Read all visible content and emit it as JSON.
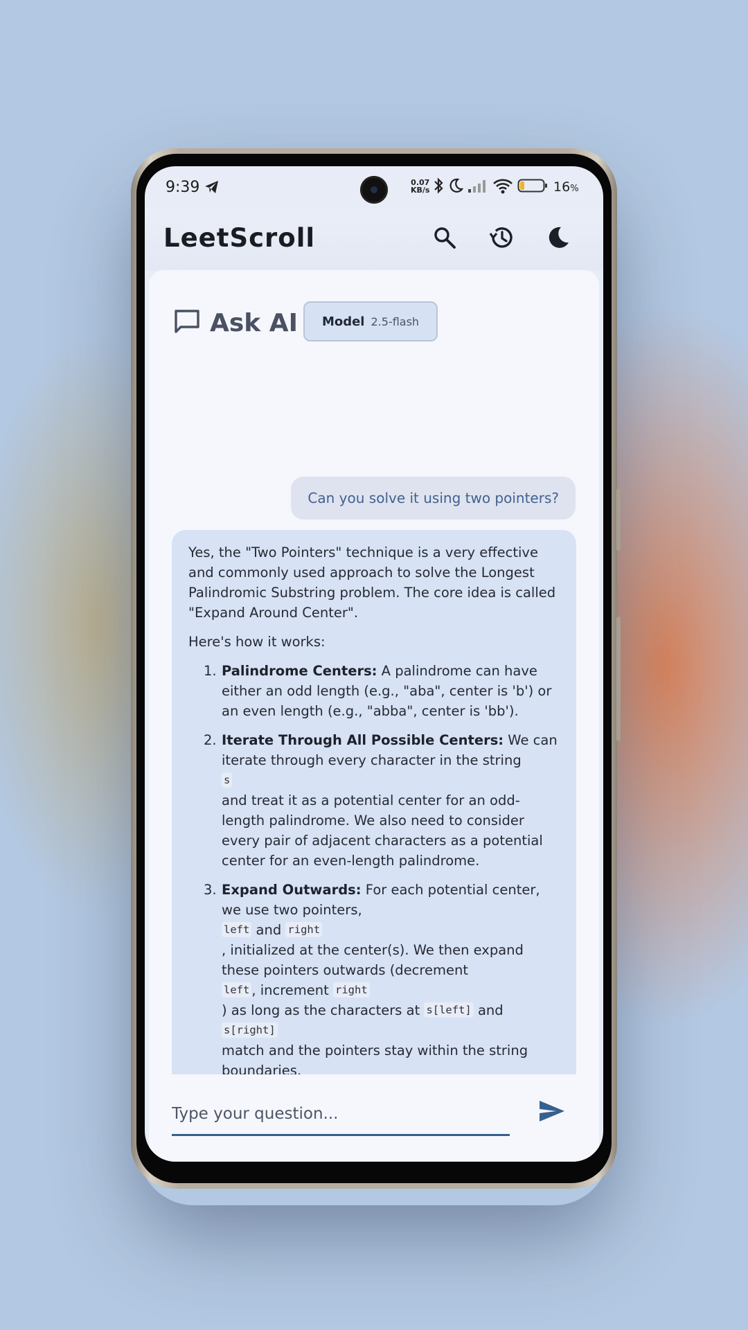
{
  "status_bar": {
    "time": "9:39",
    "net_speed_value": "0.07",
    "net_speed_unit": "KB/s",
    "battery_percent": "16",
    "battery_unit": "%"
  },
  "app_bar": {
    "title": "LeetScroll",
    "icons": [
      "search-icon",
      "history-icon",
      "dark-mode-icon"
    ]
  },
  "ask_ai": {
    "title": "Ask AI",
    "model_label": "Model",
    "model_value": "2.5-flash"
  },
  "chat": {
    "user_message": "Can you solve it using two pointers?",
    "ai_intro": "Yes, the \"Two Pointers\" technique is a very effective and commonly used approach to solve the Longest Palindromic Substring problem. The core idea is called \"Expand Around Center\".",
    "ai_how": "Here's how it works:",
    "steps": [
      {
        "num": "1.",
        "title": "Palindrome Centers:",
        "text": " A palindrome can have either an odd length (e.g., \"aba\", center is 'b') or an even length (e.g., \"abba\", center is 'bb')."
      },
      {
        "num": "2.",
        "title": "Iterate Through All Possible Centers:",
        "text_a": " We can iterate through every character in the string",
        "code_a": "s",
        "text_b": " and treat it as a potential center for an odd-length palindrome. We also need to consider every pair of adjacent characters as a potential center for an even-length palindrome."
      },
      {
        "num": "3.",
        "title": "Expand Outwards:",
        "text_a": " For each potential center, we use two pointers,",
        "code_left": "left",
        "text_and": " and ",
        "code_right": "right",
        "text_b": ", initialized at the center(s). We then expand these pointers outwards (decrement",
        "code_left2": "left",
        "text_c": ", increment ",
        "code_right2": "right",
        "text_d": ") as long as the characters at ",
        "code_sleft": "s[left]",
        "text_e": " and",
        "code_sright": "s[right]",
        "text_f": " match and the pointers stay within the string boundaries."
      }
    ]
  },
  "input": {
    "placeholder": "Type your question...",
    "value": ""
  },
  "colors": {
    "accent": "#36608f",
    "card_bg": "#f6f7fd",
    "ai_bubble_bg": "#d7e2f5",
    "user_bubble_bg": "#dfe3ef"
  }
}
